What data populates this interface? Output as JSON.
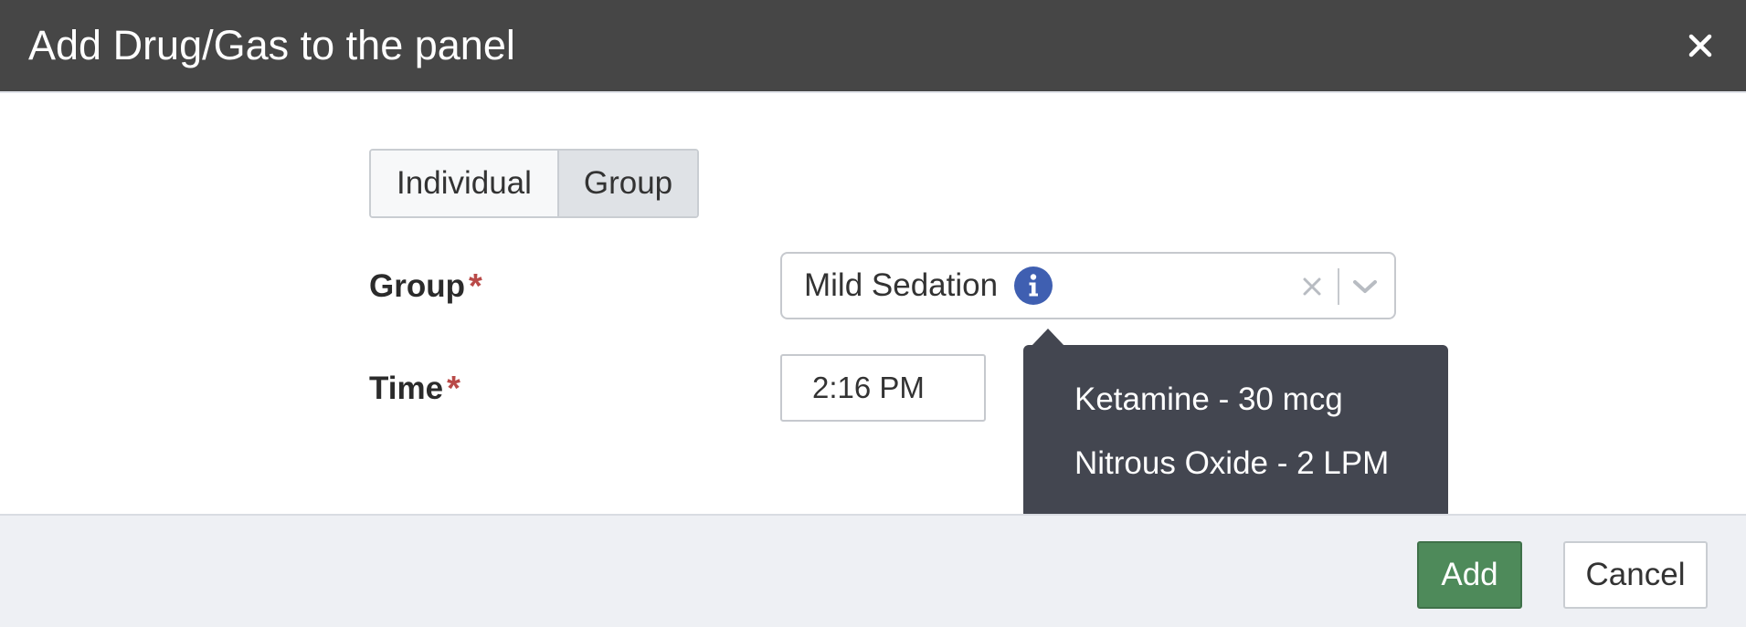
{
  "dialog": {
    "title": "Add Drug/Gas to the panel",
    "close_icon": "close-icon"
  },
  "mode_toggle": {
    "options": [
      "Individual",
      "Group"
    ],
    "selected": "Group"
  },
  "form": {
    "group": {
      "label": "Group",
      "required_mark": "*",
      "value": "Mild Sedation",
      "icons": [
        "info-icon",
        "clear-icon",
        "chevron-down-icon"
      ]
    },
    "time": {
      "label": "Time",
      "required_mark": "*",
      "value": "2:16 PM"
    }
  },
  "tooltip": {
    "items": [
      "Ketamine - 30 mcg",
      "Nitrous Oxide - 2 LPM"
    ]
  },
  "footer": {
    "add_label": "Add",
    "cancel_label": "Cancel"
  },
  "colors": {
    "header_bg": "#464646",
    "tooltip_bg": "#434650",
    "info_icon": "#3f5fb1",
    "add_button": "#4e8a5a",
    "required": "#b94a48",
    "footer_bg": "#eef0f4"
  }
}
